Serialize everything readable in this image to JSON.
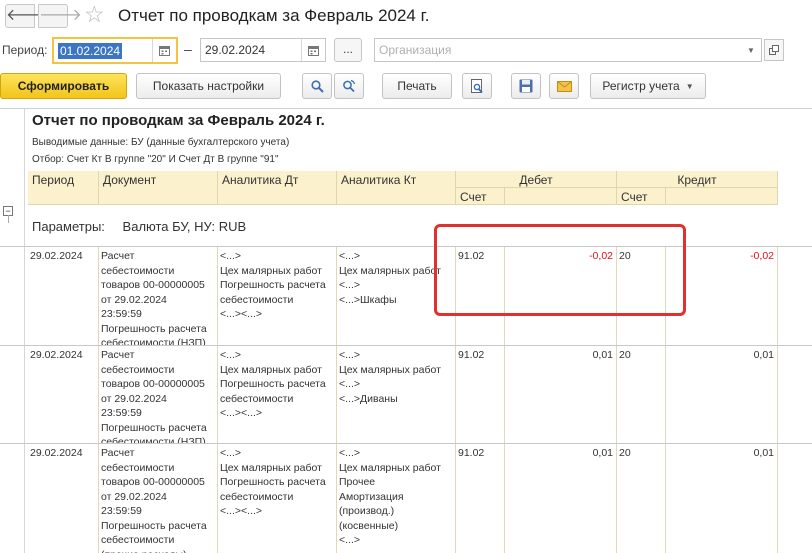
{
  "header": {
    "title": "Отчет по проводкам за Февраль 2024 г.",
    "back_icon": "🡐",
    "forward_icon": "🡒",
    "favorite_icon": "☆"
  },
  "period": {
    "label": "Период:",
    "from": "01.02.2024",
    "separator": "–",
    "to": "29.02.2024",
    "dots": "...",
    "organization_placeholder": "Организация"
  },
  "toolbar": {
    "generate": "Сформировать",
    "settings": "Показать настройки",
    "print": "Печать",
    "register": "Регистр учета"
  },
  "report": {
    "title": "Отчет по проводкам за Февраль 2024 г.",
    "data_line": "Выводимые данные: БУ (данные бухгалтерского учета)",
    "filter_line": "Отбор: Счет Кт В группе \"20\" И Счет Дт В группе \"91\"",
    "columns": {
      "period": "Период",
      "document": "Документ",
      "analytics_dt": "Аналитика Дт",
      "analytics_kt": "Аналитика Кт",
      "debit": "Дебет",
      "credit": "Кредит",
      "account": "Счет"
    },
    "params_label": "Параметры:",
    "params_value": "Валюта БУ, НУ: RUB",
    "rows": [
      {
        "period": "29.02.2024",
        "document": "Расчет\nсебестоимости\nтоваров 00-00000005\nот 29.02.2024\n23:59:59\nПогрешность расчета\nсебестоимости (НЗП)",
        "analytics_dt": "<...>\nЦех малярных работ\nПогрешность расчета\nсебестоимости\n<...><...>",
        "analytics_kt": "<...>\nЦех малярных работ\n<...>\n<...>Шкафы",
        "debit_account": "91.02",
        "debit_amount": "-0,02",
        "credit_account": "20",
        "credit_amount": "-0,02"
      },
      {
        "period": "29.02.2024",
        "document": "Расчет\nсебестоимости\nтоваров 00-00000005\nот 29.02.2024\n23:59:59\nПогрешность расчета\nсебестоимости (НЗП)",
        "analytics_dt": "<...>\nЦех малярных работ\nПогрешность расчета\nсебестоимости\n<...><...>",
        "analytics_kt": "<...>\nЦех малярных работ\n<...>\n<...>Диваны",
        "debit_account": "91.02",
        "debit_amount": "0,01",
        "credit_account": "20",
        "credit_amount": "0,01"
      },
      {
        "period": "29.02.2024",
        "document": "Расчет\nсебестоимости\nтоваров 00-00000005\nот 29.02.2024\n23:59:59\nПогрешность расчета\nсебестоимости\n(прочие расходы)",
        "analytics_dt": "<...>\nЦех малярных работ\nПогрешность расчета\nсебестоимости\n<...><...>",
        "analytics_kt": "<...>\nЦех малярных работ\nПрочее\nАмортизация\n(производ.)\n(косвенные)\n<...>",
        "debit_account": "91.02",
        "debit_amount": "0,01",
        "credit_account": "20",
        "credit_amount": "0,01"
      }
    ]
  },
  "colors": {
    "accent": "#f2c51a",
    "header_bg": "#fbf1cc",
    "negative": "#e0101a",
    "highlight": "#e03030"
  }
}
